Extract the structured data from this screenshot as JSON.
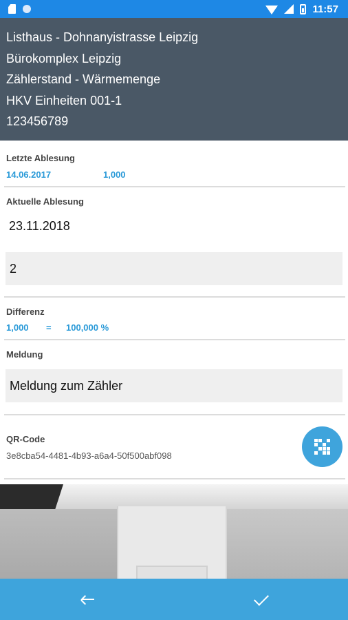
{
  "status_bar": {
    "time": "11:57",
    "icons": [
      "sim-card-icon",
      "notification-dot-icon",
      "wifi-icon",
      "signal-icon",
      "battery-icon"
    ]
  },
  "header": {
    "lines": [
      "Listhaus - Dohnanyistrasse Leipzig",
      "Bürokomplex Leipzig",
      "Zählerstand - Wärmemenge",
      "HKV Einheiten 001-1",
      "123456789"
    ]
  },
  "last_reading": {
    "label": "Letzte Ablesung",
    "date": "14.06.2017",
    "value": "1,000"
  },
  "current_reading": {
    "label": "Aktuelle Ablesung",
    "date": "23.11.2018",
    "value": "2"
  },
  "difference": {
    "label": "Differenz",
    "value": "1,000",
    "equals": "=",
    "percent": "100,000 %"
  },
  "message": {
    "label": "Meldung",
    "placeholder": "Meldung zum Zähler"
  },
  "qr": {
    "label": "QR-Code",
    "id": "3e8cba54-4481-4b93-a6a4-50f500abf098",
    "button_icon": "qr-code-icon"
  },
  "bottom_bar": {
    "back_icon": "arrow-left-icon",
    "confirm_icon": "checkmark-icon"
  },
  "colors": {
    "status_bar": "#1e88e5",
    "header_bg": "#4a5866",
    "accent_blue": "#2a9ad8",
    "bottom_bar": "#3ea4dc"
  }
}
